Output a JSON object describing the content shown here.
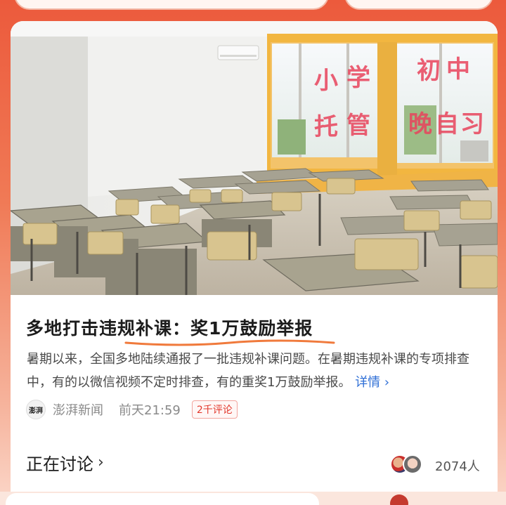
{
  "article": {
    "headline": "多地打击违规补课：奖1万鼓励举报",
    "summary": "暑期以来，全国多地陆续通报了一批违规补课问题。在暑期违规补课的专项排查中，有的以微信视频不定时排查，有的重奖1万鼓励举报。",
    "more_label": "详情 ›",
    "source_logo_text": "澎湃",
    "source_name": "澎湃新闻",
    "time": "前天21:59",
    "comment_badge": "2千评论"
  },
  "photo": {
    "window_signs": [
      "中",
      "初",
      "学",
      "小",
      "习",
      "自",
      "晚",
      "管",
      "托"
    ]
  },
  "discussion": {
    "label": "正在讨论",
    "chevron": "›",
    "participants": "2074人"
  },
  "colors": {
    "accent_blue": "#2f6fd6",
    "badge_red": "#e2382c",
    "underline_orange": "#f07a3c"
  }
}
